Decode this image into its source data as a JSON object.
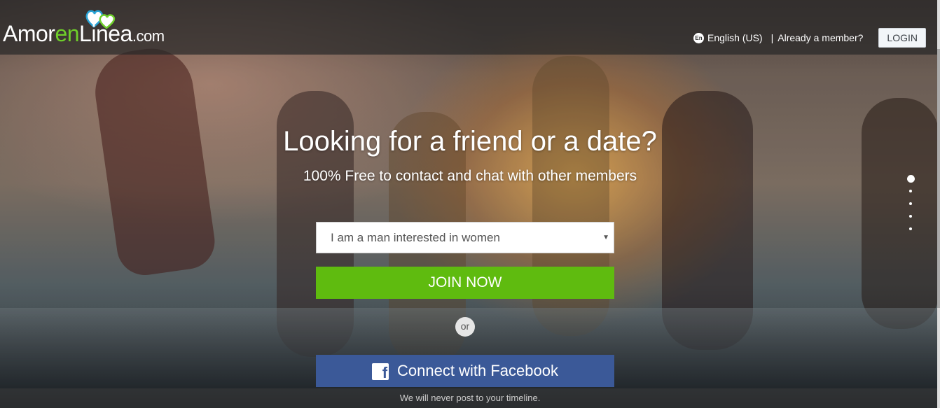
{
  "header": {
    "logo": {
      "part1": "Amor",
      "part2": "en",
      "part3": "Linea",
      "part4": ".com"
    },
    "language_icon": "En",
    "language": "English (US)",
    "separator": "|",
    "member_prompt": "Already a member?",
    "login_label": "LOGIN"
  },
  "hero": {
    "headline": "Looking for a friend or a date?",
    "subheadline": "100% Free to contact and chat with other members"
  },
  "signup": {
    "preference_value": "I am a man interested in women",
    "join_label": "JOIN NOW",
    "or_label": "or",
    "facebook_icon": "f",
    "facebook_label": "Connect with Facebook",
    "note": "We will never post to your timeline."
  },
  "slider": {
    "slide_count": 5,
    "active_slide": 1
  },
  "colors": {
    "join": "#5fbb0f",
    "facebook": "#3b5998",
    "logo_accent": "#6fcf2a"
  }
}
